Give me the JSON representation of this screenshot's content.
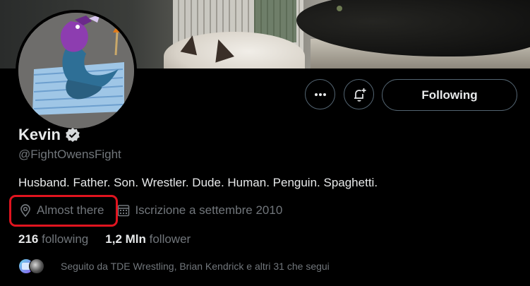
{
  "profile": {
    "name": "Kevin",
    "handle": "@FightOwensFight",
    "bio": "Husband. Father. Son. Wrestler. Dude. Human. Penguin. Spaghetti.",
    "location": "Almost there",
    "joined": "Iscrizione a settembre 2010",
    "following_count": "216",
    "following_label": "following",
    "followers_count": "1,2 Mln",
    "followers_label": "follower",
    "followed_by": "Seguito da TDE Wrestling, Brian Kendrick e altri 31 che segui"
  },
  "actions": {
    "follow_label": "Following",
    "more_icon": "more-icon",
    "bell_icon": "bell-plus-icon"
  },
  "colors": {
    "background": "#000000",
    "primary_text": "#e7e9ea",
    "secondary_text": "#71767b",
    "border": "#536471",
    "highlight": "#e0141f"
  }
}
